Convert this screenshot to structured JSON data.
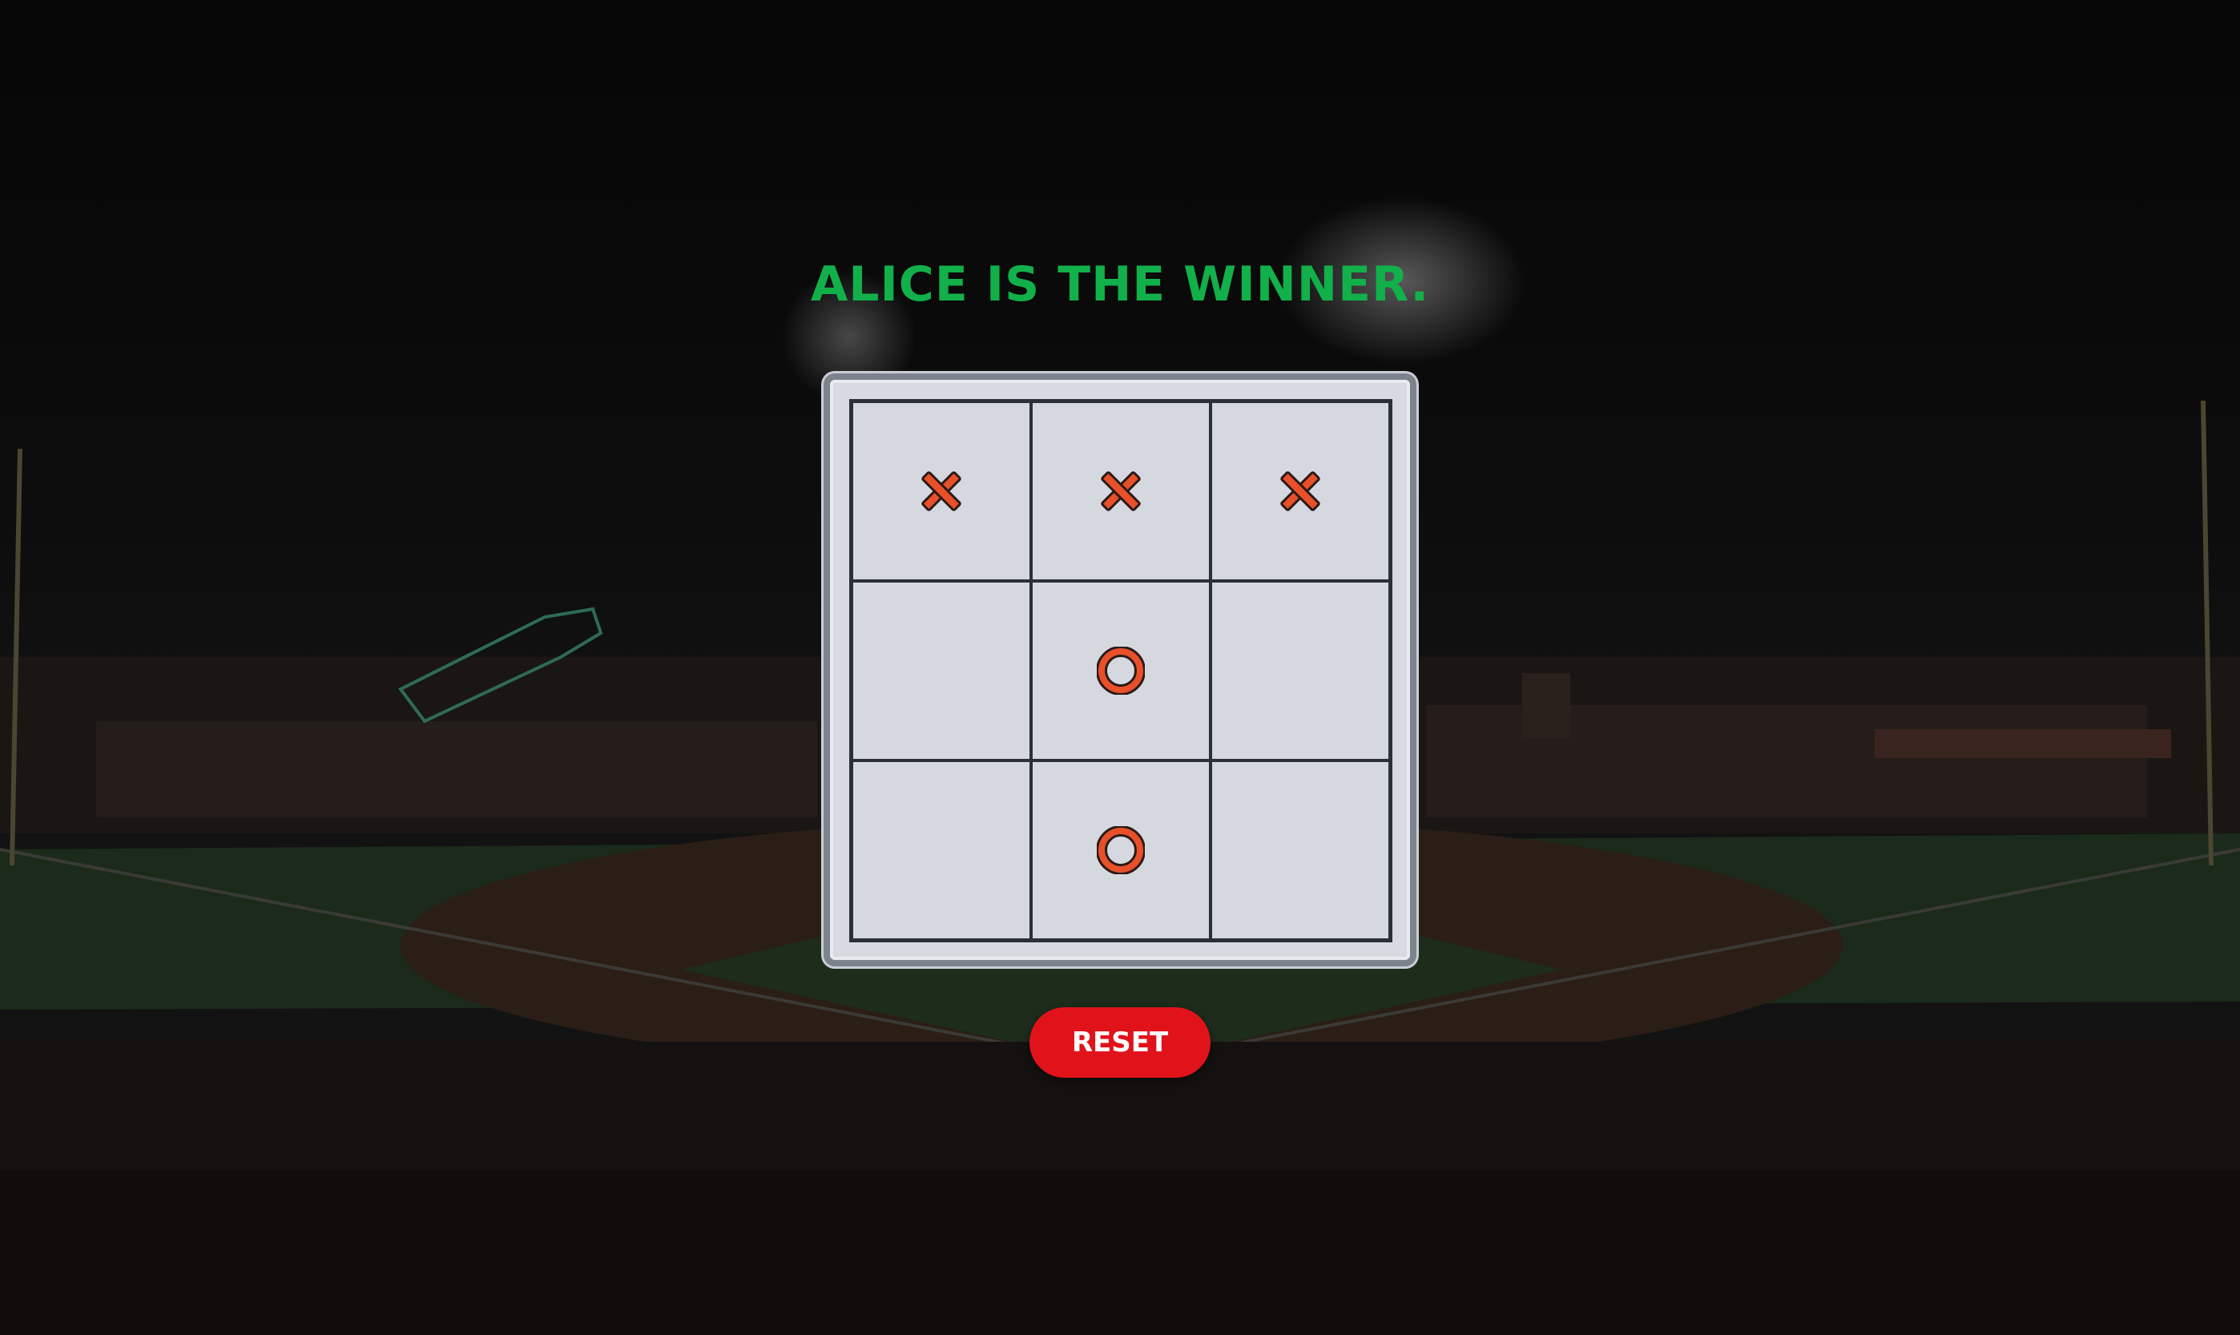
{
  "status_message": "ALICE IS THE WINNER.",
  "board": {
    "cells": [
      "X",
      "X",
      "X",
      "",
      "O",
      "",
      "",
      "O",
      ""
    ]
  },
  "reset_label": "RESET",
  "colors": {
    "status": "#12b04a",
    "mark_fill": "#e8502a",
    "mark_outline": "#2b1a17",
    "button": "#e0131b",
    "board": "#d5d9df"
  },
  "icons": {
    "X": "cross-icon",
    "O": "ring-icon"
  }
}
